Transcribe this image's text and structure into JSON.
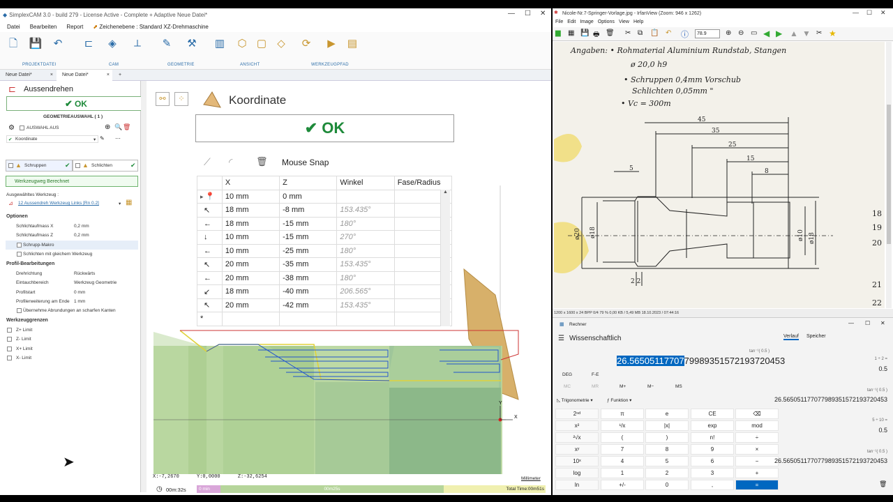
{
  "app": {
    "title": "SimplexCAM 3.0 - build 279 - License Active - Complete + Adaptive Neue Datei*",
    "menu": [
      "Datei",
      "Bearbeiten",
      "Report"
    ],
    "drawing_plane": "Zeichenebene : Standard XZ-Drehmaschine",
    "ribbon_groups": [
      "PROJEKTDATEI",
      "CAM",
      "GEOMETRIE",
      "ANSICHT",
      "WERKZEUGPFAD"
    ],
    "tabs": [
      "Neue Datei*",
      "Neue Datei*"
    ],
    "tab_close": "×",
    "tab_add": "+"
  },
  "left": {
    "heading": "Aussendrehen",
    "ok": "OK",
    "geom_header": "GEOMETRIEAUSWAHL ( 1 )",
    "selection_off": "AUSWAHL AUS",
    "geometry": "Koordinate",
    "strategy1": "Schruppen",
    "strategy2": "Schlichten",
    "toolpath_status": "Werkzeugweg Berechnet",
    "tool_label": "Ausgewähltes Werkzeug :",
    "tool_value": "12 Aussendreh Werkzeug Links [Rn 0.2]",
    "options_header": "Optionen",
    "opt1_label": "Schlichtaufmass X",
    "opt1_value": "0,2 mm",
    "opt2_label": "Schlichtaufmass Z",
    "opt2_value": "0,2 mm",
    "opt3_label": "Schrupp-Makro",
    "opt4_label": "Schlichten mit gleichem Werkzeug",
    "profile_header": "Profil-Bearbeitungen",
    "p1_label": "Drehrichtung",
    "p1_value": "Rückwärts",
    "p2_label": "Eintauchbereich",
    "p2_value": "Werkzeug Geometrie",
    "p3_label": "Profilstart",
    "p3_value": "0 mm",
    "p4_label": "Profilerweiterung am Ende",
    "p4_value": "1 mm",
    "p5_label": "Übernehme Abrundungen an scharfen Kanten",
    "limits_header": "Werkzeuggrenzen",
    "limits": [
      "Z+ Limit",
      "Z- Limit",
      "X+ Limit",
      "X- Limit"
    ]
  },
  "canvas": {
    "title": "Koordinate",
    "ok": "OK",
    "mouse_snap": "Mouse Snap",
    "columns": [
      "X",
      "Z",
      "Winkel",
      "Fase/Radius"
    ],
    "rows": [
      {
        "x": "10 mm",
        "z": "0 mm",
        "angle": "",
        "arrow": "📍"
      },
      {
        "x": "18 mm",
        "z": "-8 mm",
        "angle": "153.435°",
        "arrow": "↖"
      },
      {
        "x": "18 mm",
        "z": "-15 mm",
        "angle": "180°",
        "arrow": "←"
      },
      {
        "x": "10 mm",
        "z": "-15 mm",
        "angle": "270°",
        "arrow": "↓"
      },
      {
        "x": "10 mm",
        "z": "-25 mm",
        "angle": "180°",
        "arrow": "←"
      },
      {
        "x": "20 mm",
        "z": "-35 mm",
        "angle": "153.435°",
        "arrow": "↖"
      },
      {
        "x": "20 mm",
        "z": "-38 mm",
        "angle": "180°",
        "arrow": "←"
      },
      {
        "x": "18 mm",
        "z": "-40 mm",
        "angle": "206.565°",
        "arrow": "↙"
      },
      {
        "x": "20 mm",
        "z": "-42 mm",
        "angle": "153.435°",
        "arrow": "↖"
      }
    ],
    "coords": "X:-7,2670      Y:0,0000      Z:-32,6254",
    "units": "Millimeter",
    "axis_y": "Y",
    "axis_x": "X",
    "time": "00m:32s",
    "seg1": "0 min",
    "seg2": "00m25s",
    "total": "Total Time:00m51s"
  },
  "viewer": {
    "title": "Nicole-Nr.7-Springer-Vorlage.jpg - IrfanView (Zoom: 946 x 1262)",
    "menu": [
      "File",
      "Edit",
      "Image",
      "Options",
      "View",
      "Help"
    ],
    "zoom": "78.9",
    "status": "1200 x 1600 x 24 BPP    0/4    79 %    0,00 KB / 5,49 MB    18.10.2023 / 07:44:16",
    "notes": [
      "Angaben: • Rohmaterial Aluminium Rundstab, Stangen",
      "ø 20,0 h9",
      "• Schruppen 0,4mm Vorschub",
      "Schlichten 0,05mm \"",
      "• Vc = 300m"
    ],
    "dims": [
      "45",
      "35",
      "25",
      "15",
      "8",
      "5",
      "2 2",
      "ø20",
      "ø18",
      "ø10",
      "ø18"
    ],
    "margin_nums": [
      "18",
      "19",
      "20",
      "21",
      "22"
    ]
  },
  "calc": {
    "title": "Rechner",
    "mode": "Wissenschaftlich",
    "tab_history": "Verlauf",
    "tab_memory": "Speicher",
    "expr": "tan⁻¹( 0.5 )",
    "display_sel": "26.56505117707",
    "display_rest": "79989351572193720453",
    "deg": "DEG",
    "fe": "F-E",
    "mem": [
      "MC",
      "MR",
      "M+",
      "M−",
      "MS"
    ],
    "trig": "Trigonometrie",
    "func": "Funktion",
    "keys": [
      [
        "2ⁿᵈ",
        "π",
        "e",
        "CE",
        "⌫"
      ],
      [
        "x²",
        "¹/x",
        "|x|",
        "exp",
        "mod"
      ],
      [
        "²√x",
        "(",
        ")",
        "n!",
        "÷"
      ],
      [
        "xʸ",
        "7",
        "8",
        "9",
        "×"
      ],
      [
        "10ˣ",
        "4",
        "5",
        "6",
        "−"
      ],
      [
        "log",
        "1",
        "2",
        "3",
        "+"
      ],
      [
        "ln",
        "+/-",
        "0",
        ",",
        "="
      ]
    ],
    "history": [
      {
        "e": "1  ÷  2 =",
        "v": "0.5"
      },
      {
        "e": "tan⁻¹( 0.5 )",
        "v": "26.565051177077989351572193720453"
      },
      {
        "e": "5  ÷  10 =",
        "v": "0.5"
      },
      {
        "e": "tan⁻¹( 0.5 )",
        "v": "26.565051177077989351572193720453"
      }
    ]
  }
}
